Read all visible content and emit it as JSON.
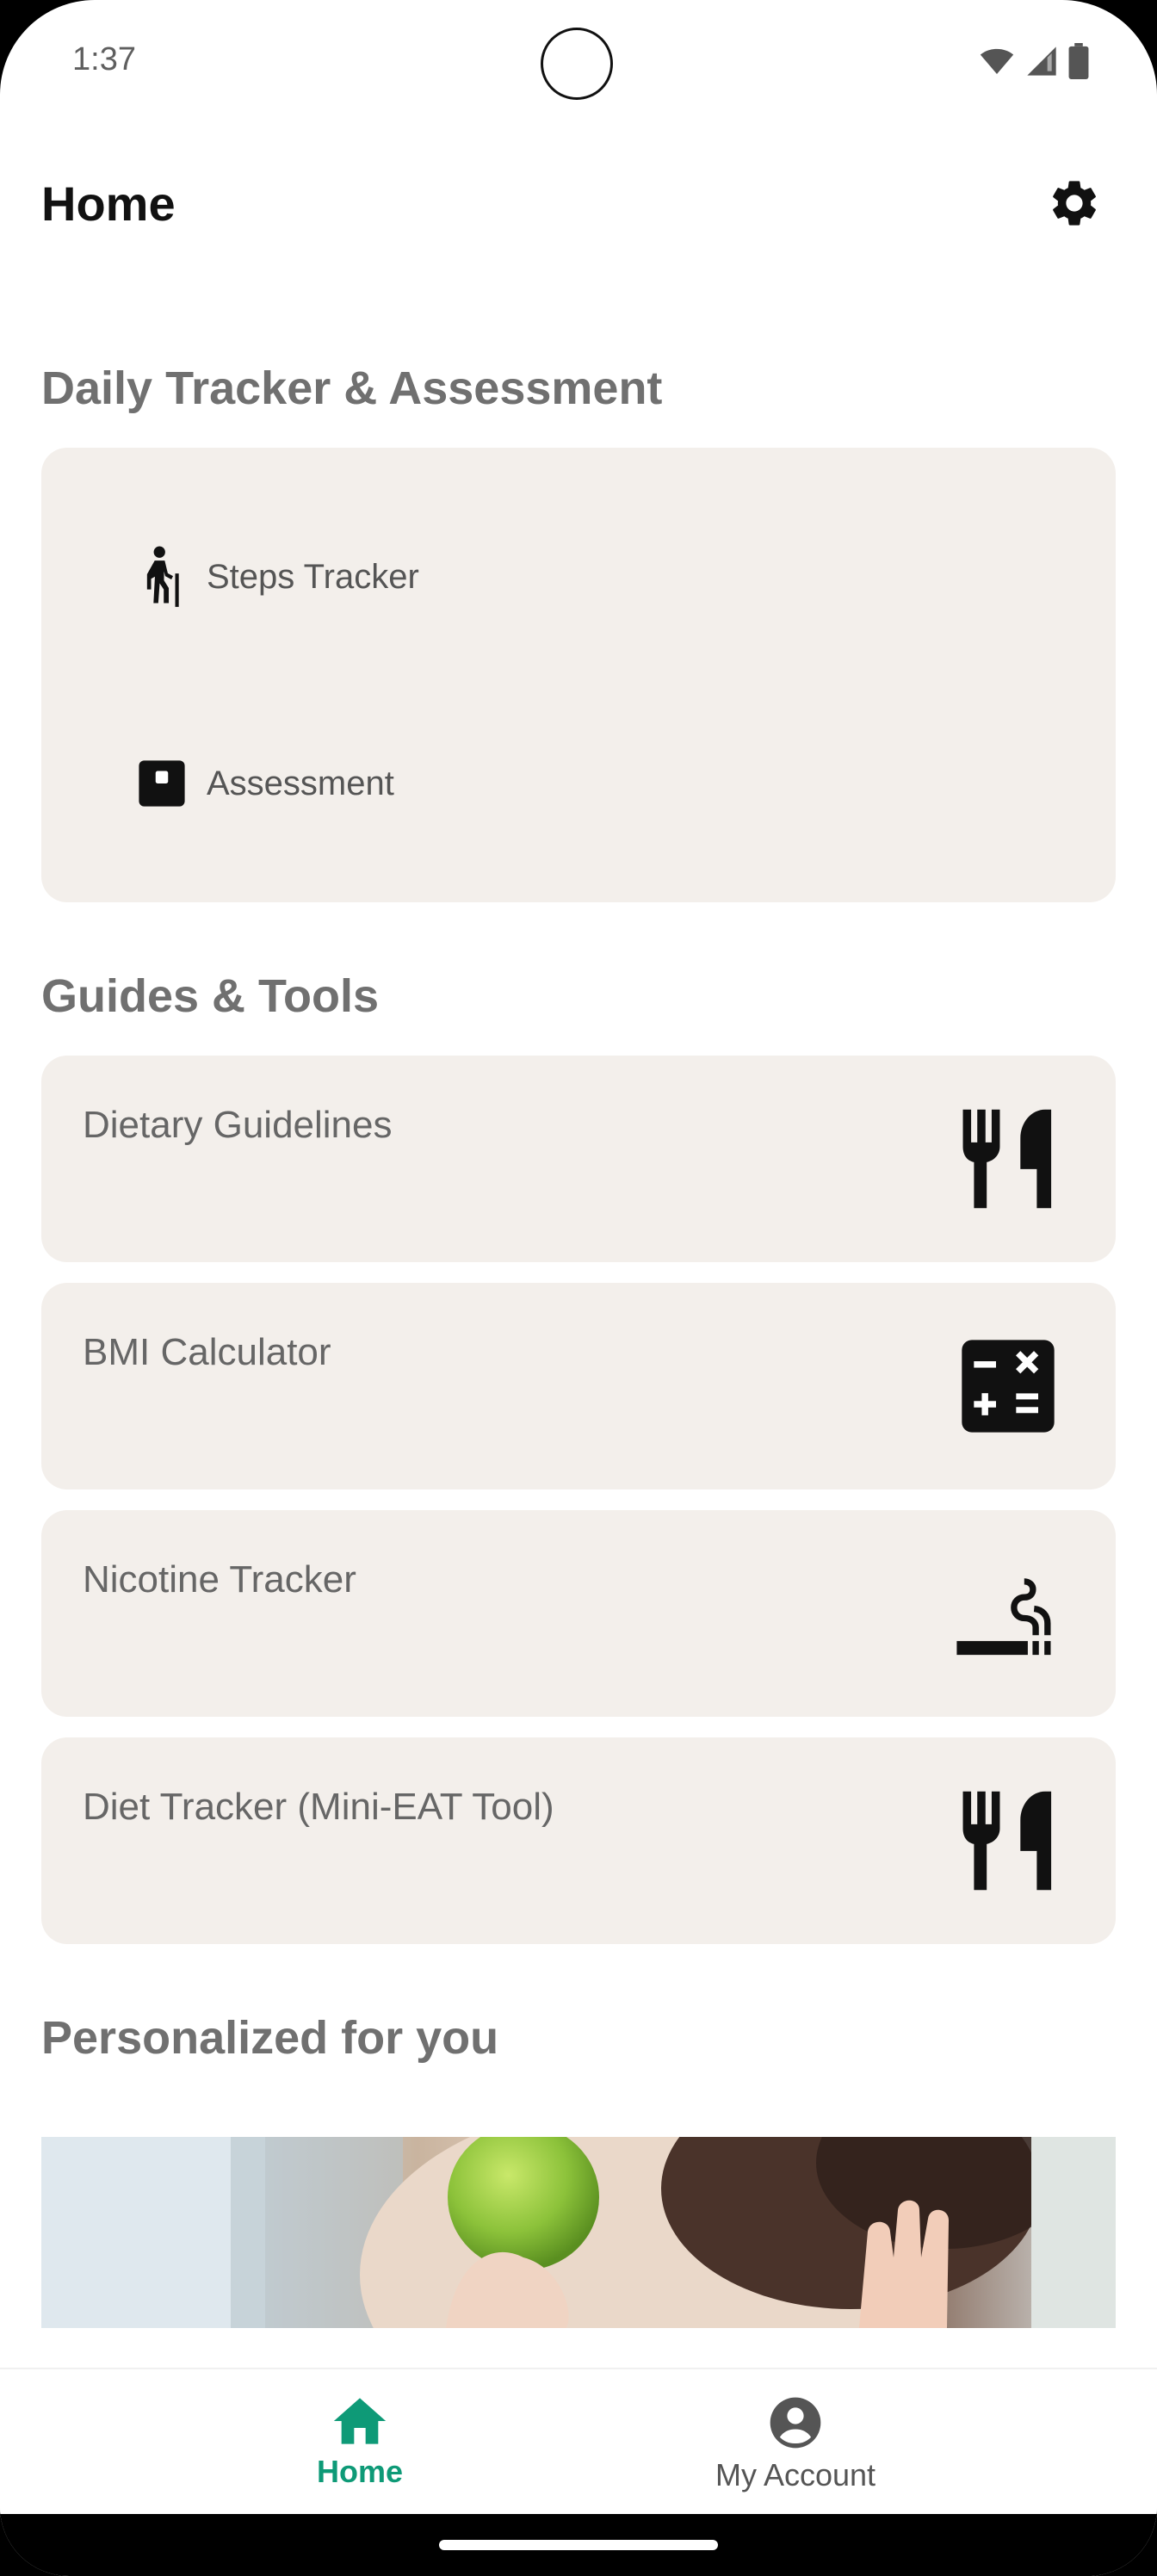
{
  "status_bar": {
    "time": "1:37"
  },
  "header": {
    "title": "Home",
    "settings_icon": "gear-icon"
  },
  "daily_section": {
    "title": "Daily Tracker & Assessment",
    "items": [
      {
        "label": "Steps Tracker",
        "icon": "walking-icon"
      },
      {
        "label": "Assessment",
        "icon": "assessment-icon"
      }
    ]
  },
  "guides_section": {
    "title": "Guides & Tools",
    "items": [
      {
        "label": "Dietary Guidelines",
        "icon": "restaurant-icon"
      },
      {
        "label": "BMI Calculator",
        "icon": "calculator-icon"
      },
      {
        "label": "Nicotine Tracker",
        "icon": "smoking-icon"
      },
      {
        "label": "Diet Tracker (Mini-EAT Tool)",
        "icon": "restaurant-icon"
      }
    ]
  },
  "personalized_section": {
    "title": "Personalized for you"
  },
  "bottom_nav": {
    "items": [
      {
        "label": "Home",
        "icon": "home-icon",
        "active": true
      },
      {
        "label": "My Account",
        "icon": "account-circle-icon",
        "active": false
      }
    ],
    "active_color": "#0e9a77",
    "inactive_color": "#555555"
  },
  "colors": {
    "card_bg": "#f3efeb",
    "section_title": "#707070"
  }
}
